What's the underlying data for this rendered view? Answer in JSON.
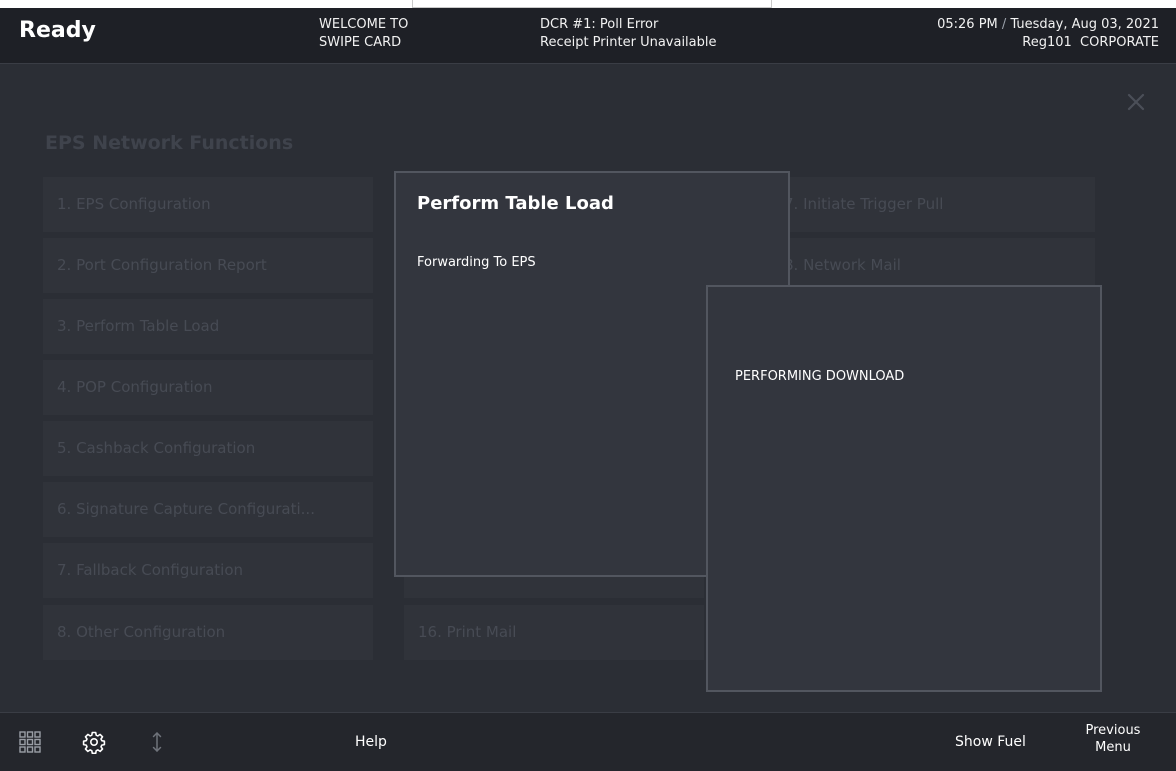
{
  "header": {
    "status": "Ready",
    "welcome_line1": "WELCOME TO",
    "welcome_line2": "SWIPE CARD",
    "alert_line1": "DCR #1: Poll Error",
    "alert_line2": "Receipt Printer Unavailable",
    "time": "05:26 PM",
    "separator": "/",
    "date": "Tuesday, Aug 03, 2021",
    "register": "Reg101",
    "store": "CORPORATE"
  },
  "menu": {
    "title": "EPS Network Functions",
    "close_icon": "close-icon",
    "left_items": [
      "1. EPS Configuration",
      "2. Port Configuration Report",
      "3. Perform Table Load",
      "4. POP Configuration",
      "5. Cashback Configuration",
      "6. Signature Capture Configurati...",
      "7. Fallback Configuration",
      "8. Other Configuration"
    ],
    "middle_items": [
      "16. Print Mail"
    ],
    "right_items": [
      "7. Initiate Trigger Pull",
      "8. Network Mail"
    ]
  },
  "dialog_table_load": {
    "title": "Perform Table Load",
    "message": "Forwarding To EPS"
  },
  "dialog_download": {
    "message": "PERFORMING DOWNLOAD"
  },
  "footer": {
    "icons": [
      "grid-icon",
      "gear-icon",
      "sort-arrows-icon"
    ],
    "help": "Help",
    "show_fuel": "Show Fuel",
    "previous_line1": "Previous",
    "previous_line2": "Menu"
  }
}
